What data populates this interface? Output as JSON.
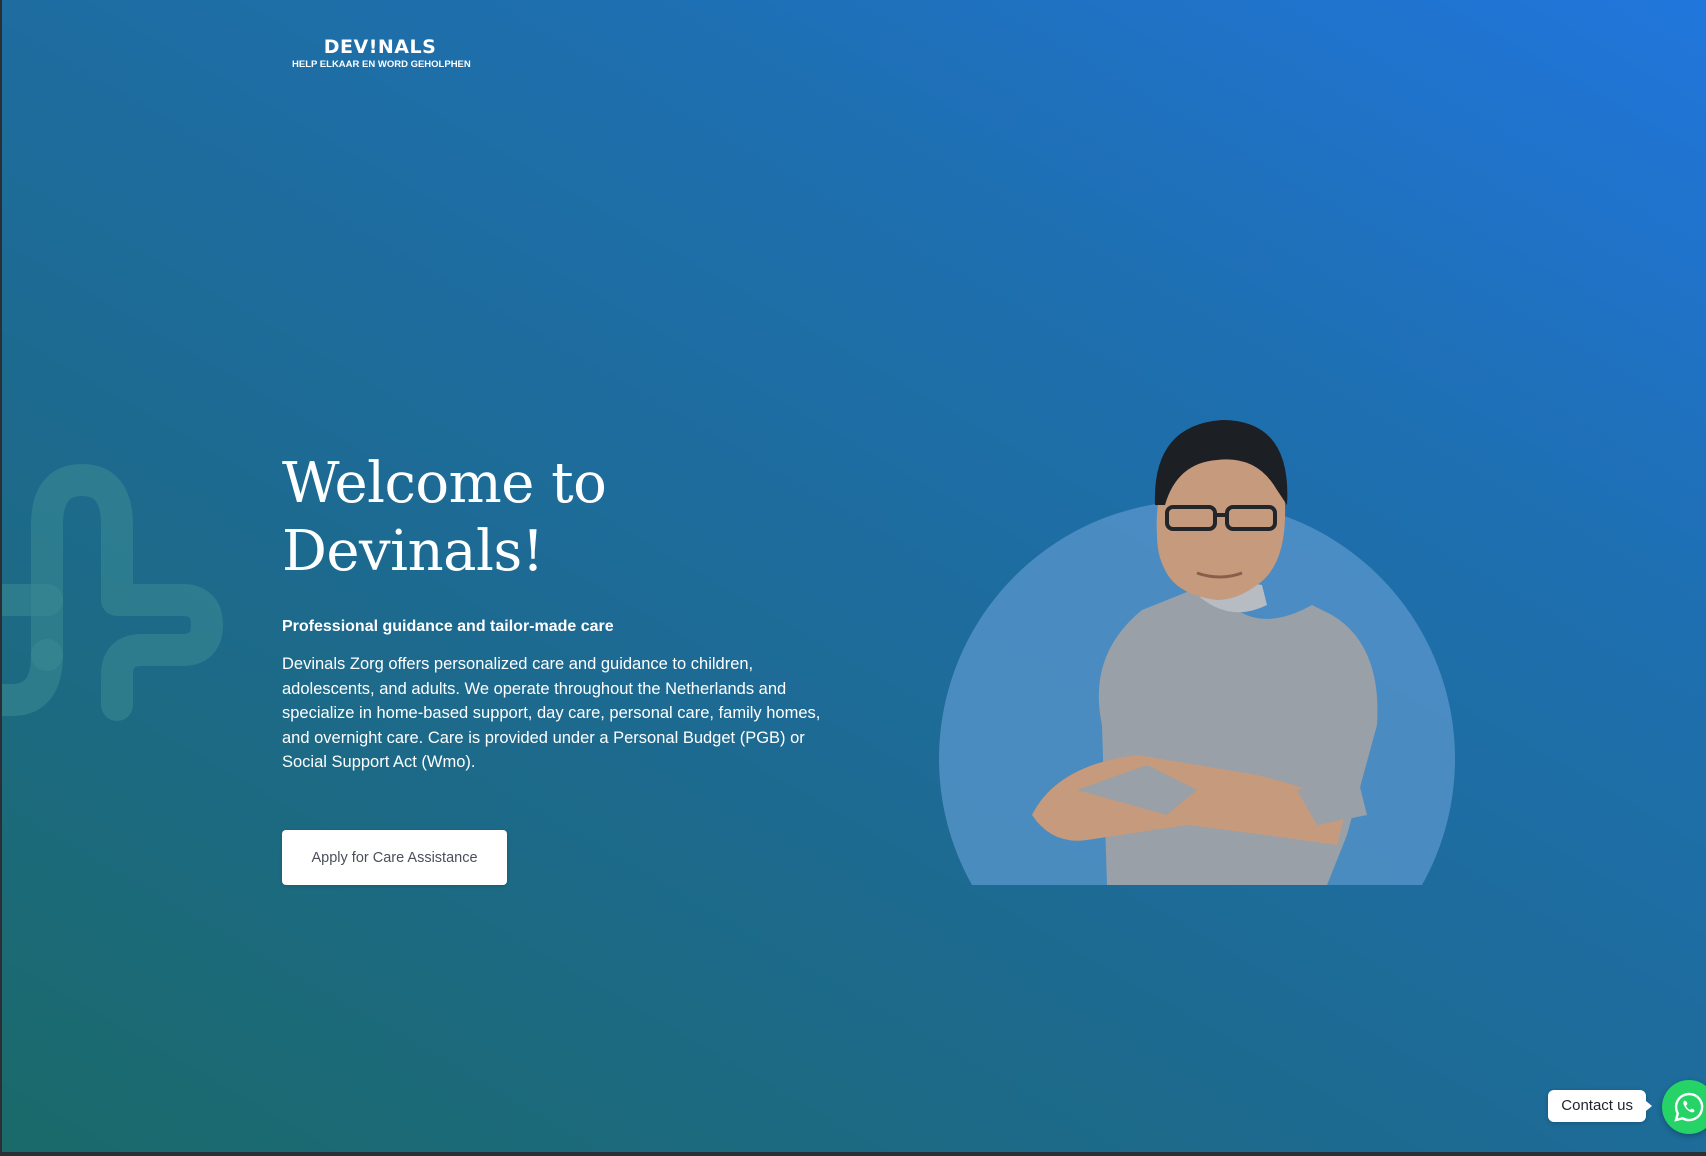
{
  "logo": {
    "name": "DEV!NALS",
    "tagline": "HELP ELKAAR EN WORD GEHOLPHEN"
  },
  "hero": {
    "title_line1": "Welcome to",
    "title_line2": "Devinals!",
    "subtitle": "Professional guidance and tailor-made care",
    "description": "Devinals Zorg offers personalized care and guidance to children, adolescents, and adults. We operate throughout the Netherlands and specialize in home-based support, day care, personal care, family homes, and overnight care. Care is provided under a Personal Budget (PGB) or Social Support Act (Wmo).",
    "cta_label": "Apply for Care Assistance"
  },
  "contact": {
    "label": "Contact us",
    "icon": "whatsapp-icon"
  },
  "colors": {
    "gradient_start": "#1a6a6a",
    "gradient_mid": "#1e6fb0",
    "gradient_end": "#2176dc",
    "circle": "#5a97cc",
    "whatsapp": "#25d366"
  }
}
